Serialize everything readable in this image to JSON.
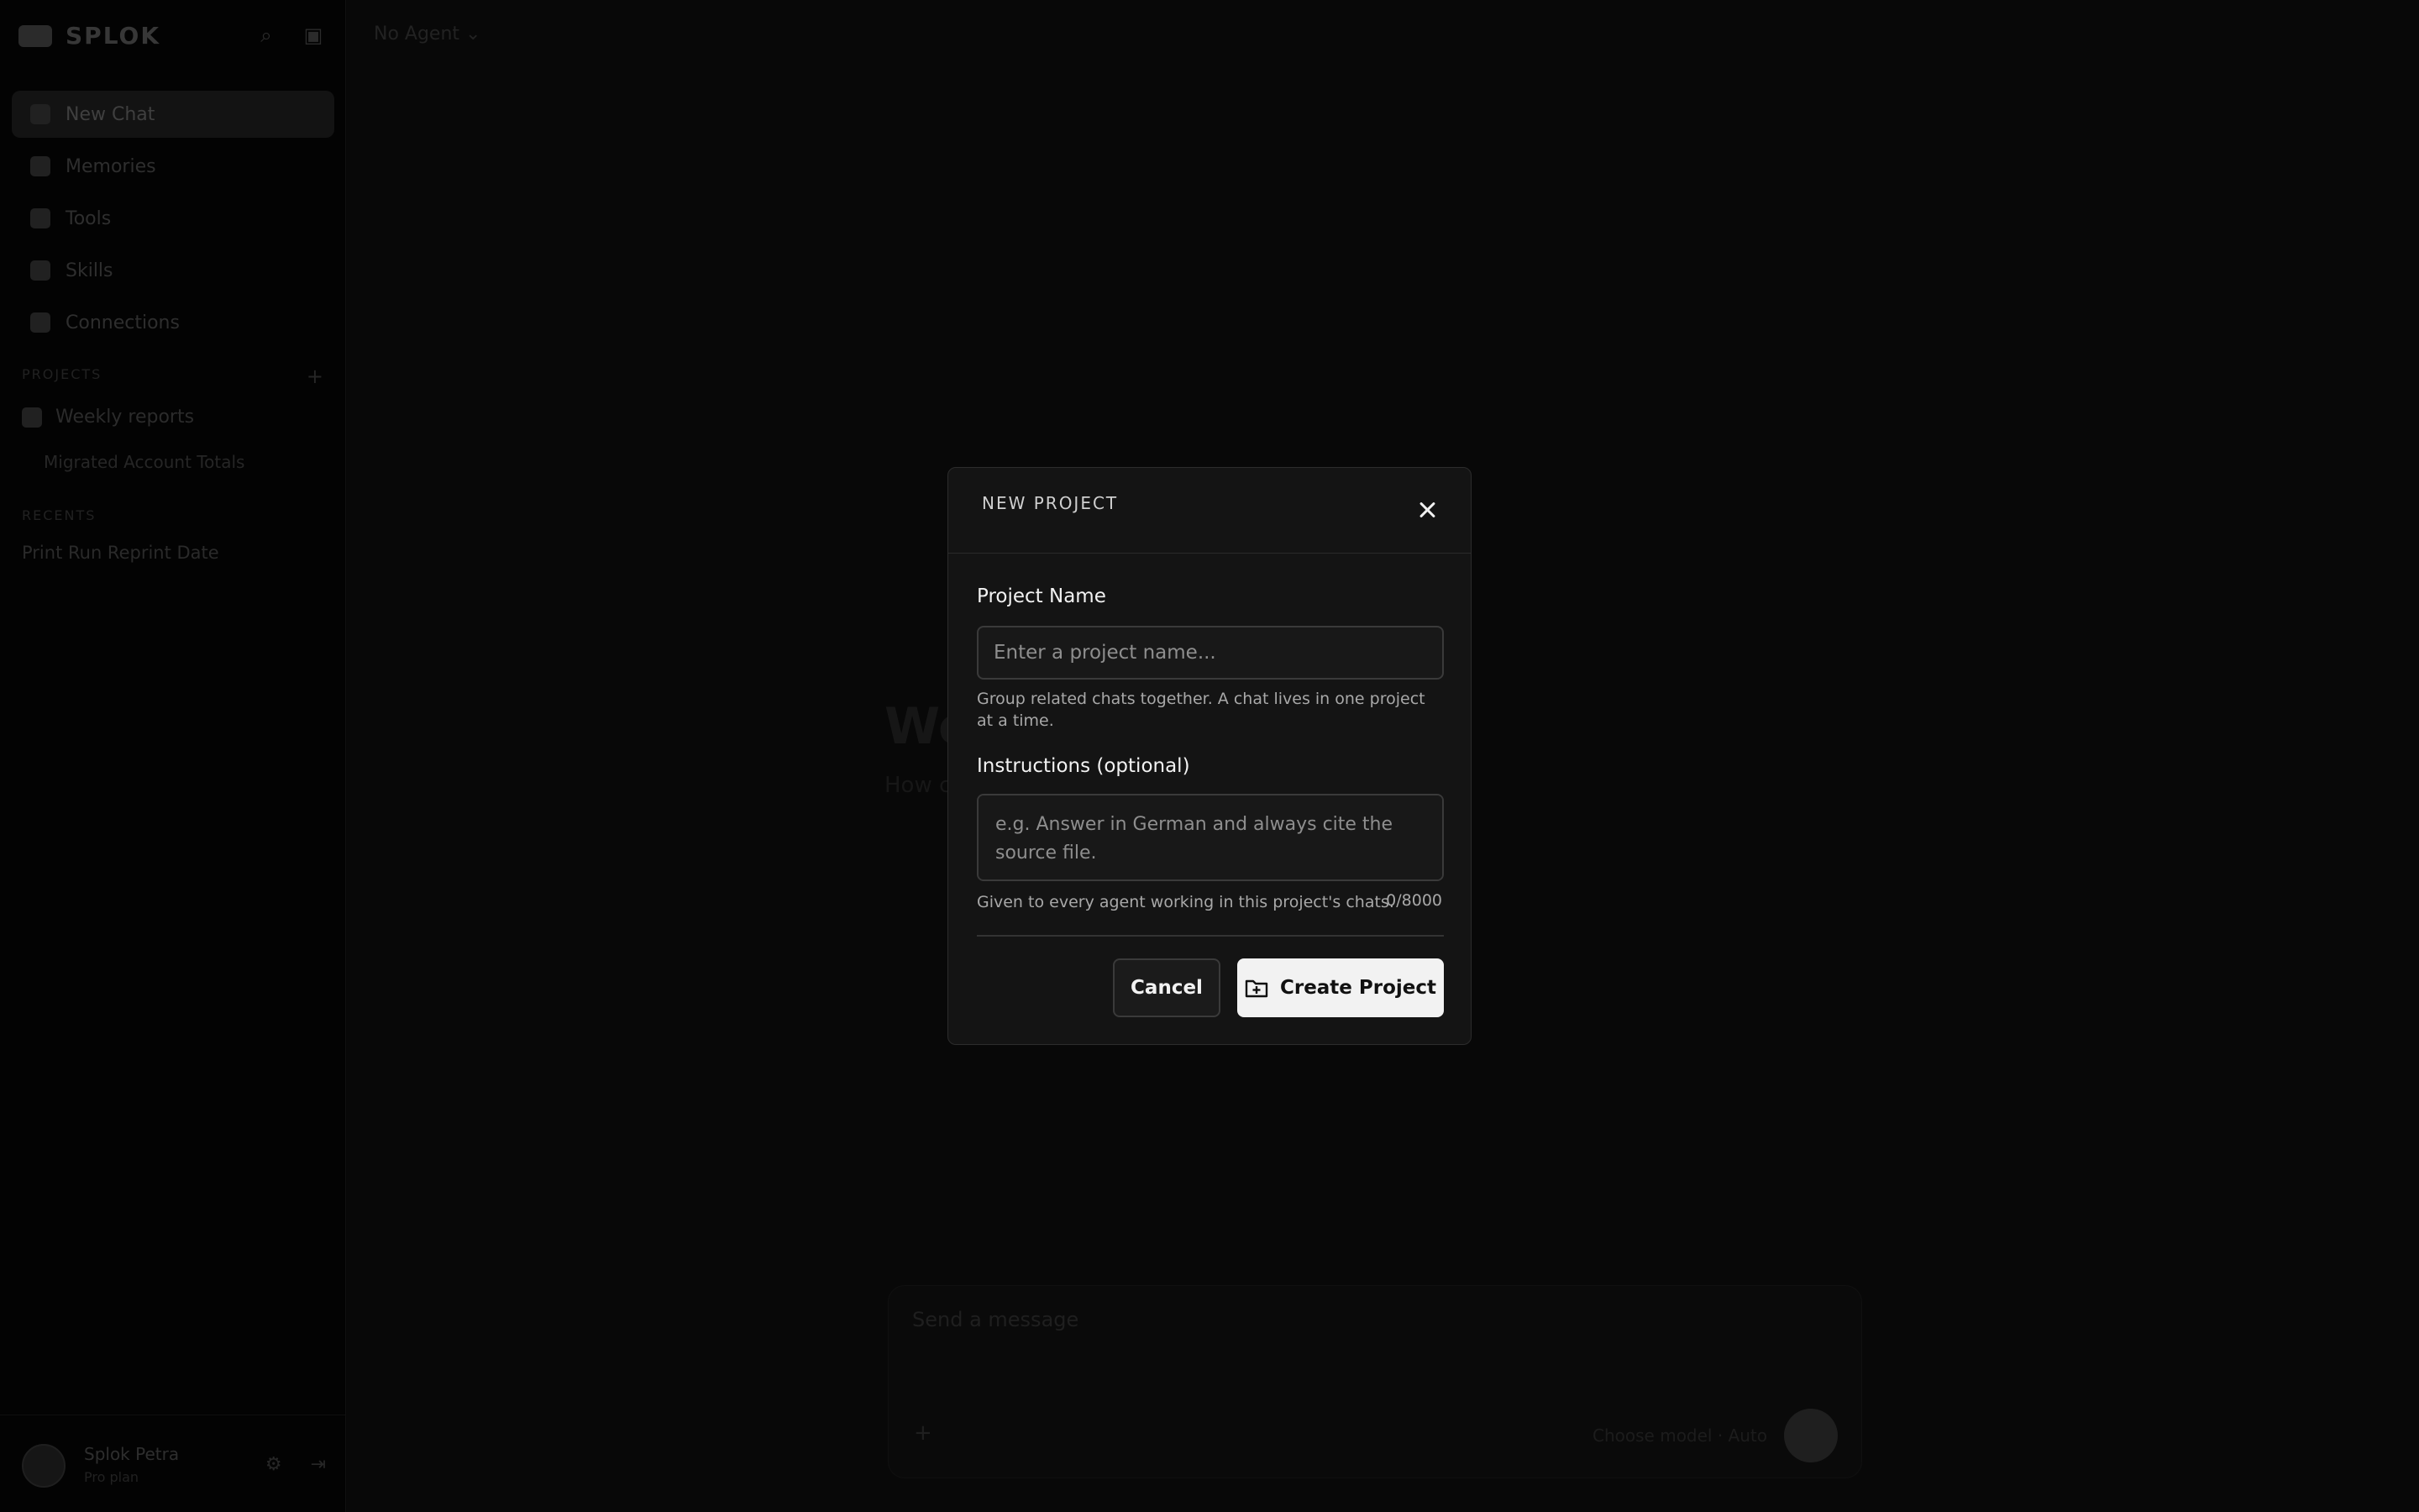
{
  "sidebar": {
    "brand": "SPLOK",
    "nav": [
      {
        "label": "New Chat"
      },
      {
        "label": "Memories"
      },
      {
        "label": "Tools"
      },
      {
        "label": "Skills"
      },
      {
        "label": "Connections"
      }
    ],
    "projects_heading": "PROJECTS",
    "projects": [
      {
        "label": "Weekly reports"
      }
    ],
    "sub_items": [
      {
        "label": "Migrated Account Totals"
      }
    ],
    "recents_heading": "RECENTS",
    "recents": [
      {
        "label": "Print Run Reprint Date"
      }
    ],
    "user": {
      "name": "Splok Petra",
      "sub": "Pro plan"
    }
  },
  "main": {
    "agent_select": "No Agent",
    "welcome": "We",
    "welcome_sub": "How c",
    "composer": {
      "placeholder": "Send a message",
      "model": "Choose model · Auto"
    }
  },
  "modal": {
    "title": "NEW PROJECT",
    "project_name_label": "Project Name",
    "project_name_placeholder": "Enter a project name...",
    "project_name_help": "Group related chats together. A chat lives in one project at a time.",
    "instructions_label": "Instructions (optional)",
    "instructions_placeholder": "e.g. Answer in German and always cite the source file.",
    "instructions_help": "Given to every agent working in this project's chats.",
    "counter": "0/8000",
    "cancel_label": "Cancel",
    "create_label": "Create Project"
  }
}
